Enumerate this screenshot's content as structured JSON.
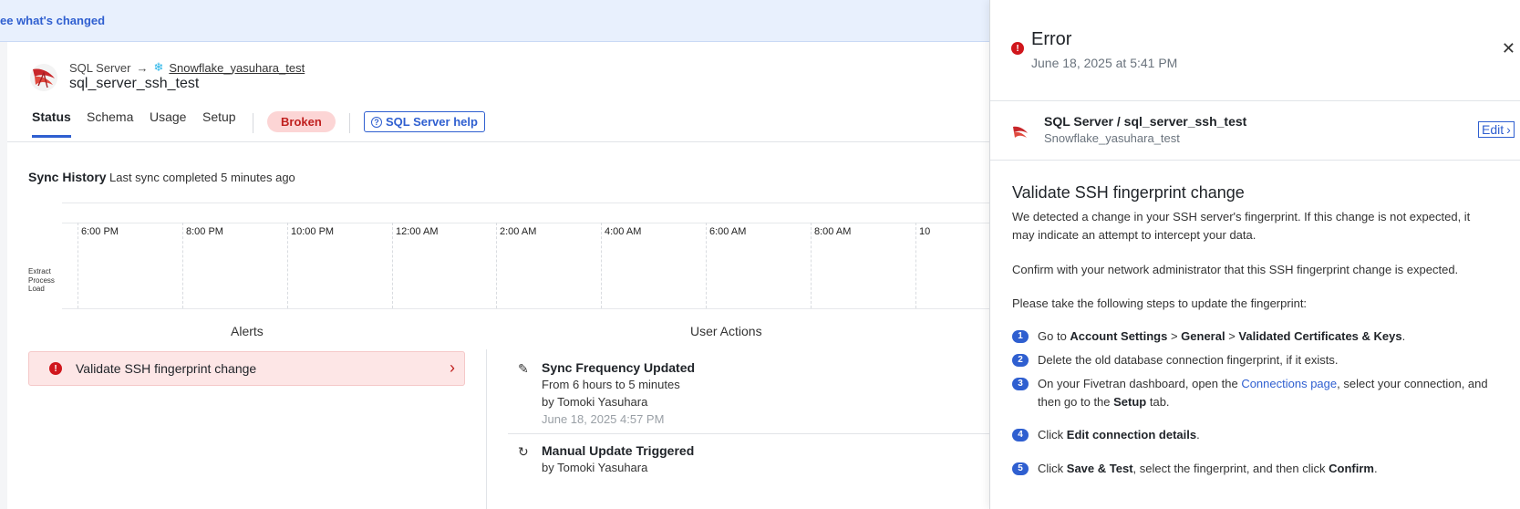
{
  "banner": {
    "link": "ee what's changed"
  },
  "header": {
    "source": "SQL Server",
    "arrow": "→",
    "destination": "Snowflake_yasuhara_test",
    "connection_name": "sql_server_ssh_test"
  },
  "tabs": [
    {
      "label": "Status",
      "active": true
    },
    {
      "label": "Schema"
    },
    {
      "label": "Usage"
    },
    {
      "label": "Setup"
    }
  ],
  "status_badge": "Broken",
  "help_button": "SQL Server help",
  "sync_history": {
    "title": "Sync History",
    "subtitle": "Last sync completed 5 minutes ago",
    "time_labels": [
      "6:00 PM",
      "8:00 PM",
      "10:00 PM",
      "12:00 AM",
      "2:00 AM",
      "4:00 AM",
      "6:00 AM",
      "8:00 AM",
      "10"
    ],
    "rows": [
      "Extract",
      "Process",
      "Load"
    ]
  },
  "alerts": {
    "title": "Alerts",
    "items": [
      {
        "label": "Validate SSH fingerprint change",
        "icon": "error-icon"
      }
    ]
  },
  "user_actions": {
    "title": "User Actions",
    "items": [
      {
        "title": "Sync Frequency Updated",
        "detail": "From 6 hours to 5 minutes",
        "by": "by Tomoki Yasuhara",
        "date": "June 18, 2025 4:57 PM",
        "icon": "pencil-icon"
      },
      {
        "title": "Manual Update Triggered",
        "by": "by Tomoki Yasuhara",
        "icon": "refresh-icon"
      }
    ]
  },
  "panel": {
    "title": "Error",
    "date": "June 18, 2025 at 5:41 PM",
    "close": "✕",
    "connection": {
      "name": "SQL Server / sql_server_ssh_test",
      "destination": "Snowflake_yasuhara_test",
      "edit_label": "Edit"
    },
    "heading": "Validate SSH fingerprint change",
    "para1": "We detected a change in your SSH server's fingerprint. If this change is not expected, it may indicate an attempt to intercept your data.",
    "para2": "Confirm with your network administrator that this SSH fingerprint change is expected.",
    "para3": "Please take the following steps to update the fingerprint:",
    "steps": {
      "s1": {
        "num": "1",
        "pre": "Go to ",
        "b1": "Account Settings",
        "sep1": " > ",
        "b2": "General",
        "sep2": " > ",
        "b3": "Validated Certificates & Keys",
        "post": "."
      },
      "s2": {
        "num": "2",
        "text": "Delete the old database connection fingerprint, if it exists."
      },
      "s3": {
        "num": "3",
        "pre": "On your Fivetran dashboard, open the ",
        "link": "Connections page",
        "mid": ", select your connection, and then go to the ",
        "b1": "Setup",
        "post": " tab."
      },
      "s4": {
        "num": "4",
        "pre": "Click ",
        "b1": "Edit connection details",
        "post": "."
      },
      "s5": {
        "num": "5",
        "pre": "Click ",
        "b1": "Save & Test",
        "mid": ", select the fingerprint, and then click ",
        "b2": "Confirm",
        "post": "."
      }
    }
  },
  "colors": {
    "accent": "#2f5fd0",
    "error": "#d0161c",
    "broken_bg": "#fcd5d5",
    "alert_bg": "#fde6e6"
  }
}
